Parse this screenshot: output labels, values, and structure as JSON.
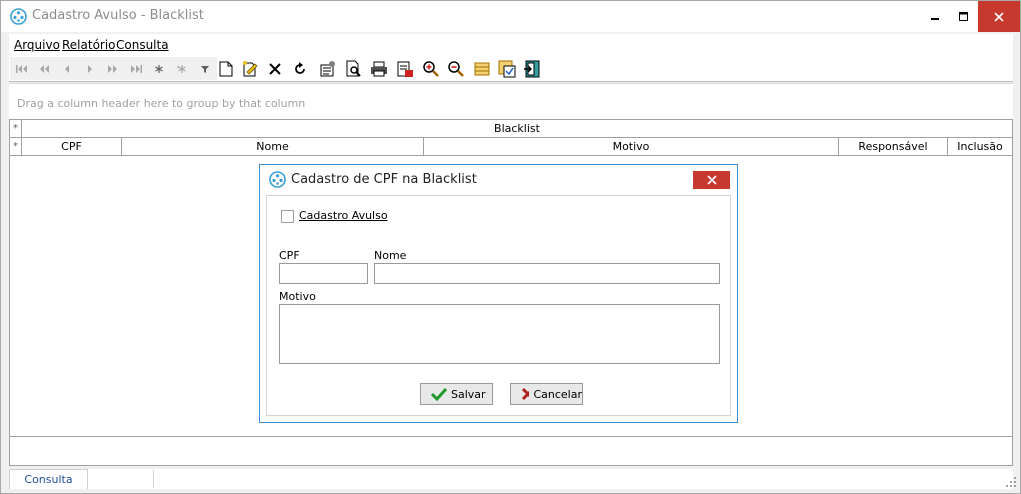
{
  "window": {
    "title": "Cadastro Avulso - Blacklist"
  },
  "menu": {
    "items": [
      "Arquivo",
      "Relatório",
      "Consulta"
    ]
  },
  "group_panel": {
    "hint": "Drag a column header here to group by that column"
  },
  "grid": {
    "band": "Blacklist",
    "columns": [
      "CPF",
      "Nome",
      "Motivo",
      "Responsável",
      "Inclusão"
    ],
    "indicator": "*"
  },
  "tabs": [
    "Consulta"
  ],
  "dialog": {
    "title": "Cadastro de CPF na Blacklist",
    "checkbox_label": "Cadastro Avulso",
    "checkbox_checked": false,
    "cpf_label": "CPF",
    "cpf_value": "",
    "nome_label": "Nome",
    "nome_value": "",
    "motivo_label": "Motivo",
    "motivo_value": "",
    "save_label": "Salvar",
    "cancel_label": "Cancelar"
  },
  "colors": {
    "close_red": "#c7392f",
    "dialog_border": "#3c8dd4",
    "tab_text": "#1f4e9c"
  }
}
